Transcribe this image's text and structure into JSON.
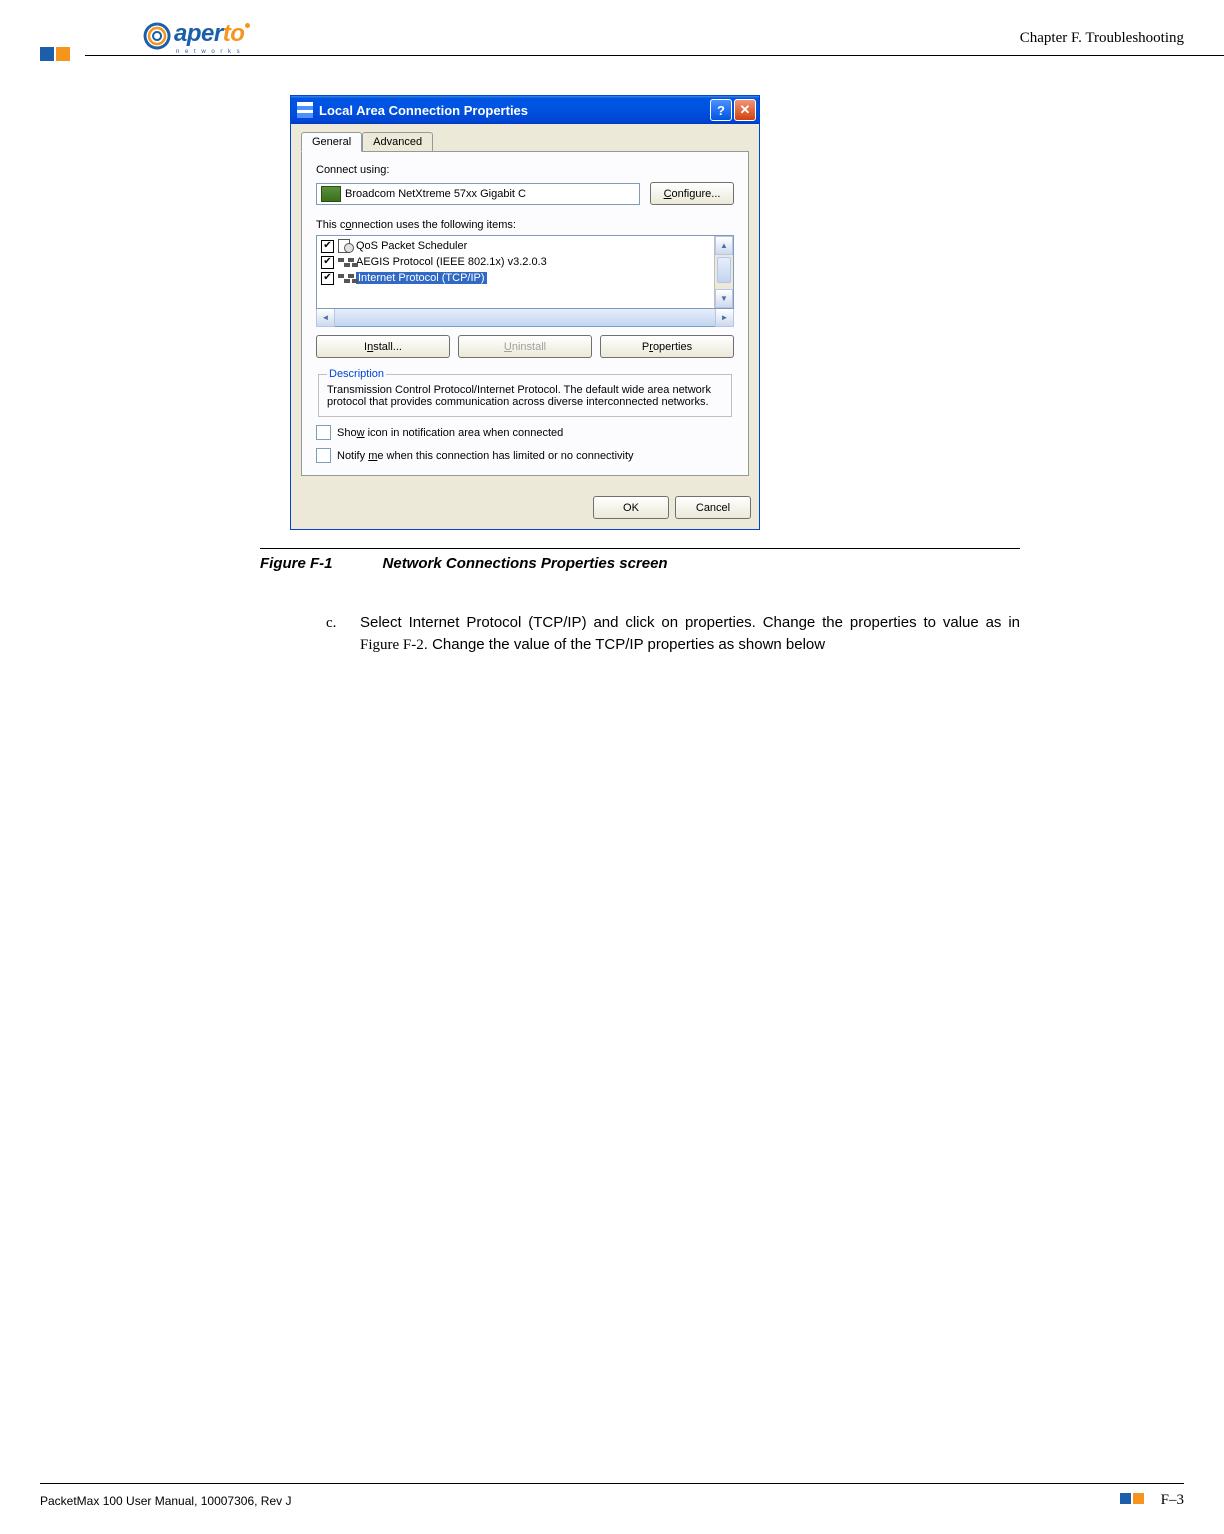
{
  "header": {
    "chapter": "Chapter F.  Troubleshooting",
    "logo_text1": "aper",
    "logo_text2": "to",
    "logo_sub": "n e t w o r k s"
  },
  "dialog": {
    "title": "Local Area Connection Properties",
    "tabs": {
      "general": "General",
      "advanced": "Advanced"
    },
    "connect_using_label": "Connect using:",
    "adapter_name": "Broadcom NetXtreme 57xx Gigabit C",
    "configure_btn": "Configure...",
    "items_label": "This connection uses the following items:",
    "items": [
      {
        "label": "QoS Packet Scheduler",
        "checked": true,
        "selected": false,
        "icon": "sched"
      },
      {
        "label": "AEGIS Protocol (IEEE 802.1x) v3.2.0.3",
        "checked": true,
        "selected": false,
        "icon": "net"
      },
      {
        "label": "Internet Protocol (TCP/IP)",
        "checked": true,
        "selected": true,
        "icon": "net"
      }
    ],
    "install_btn": "Install...",
    "uninstall_btn": "Uninstall",
    "properties_btn": "Properties",
    "desc_legend": "Description",
    "desc_text": "Transmission Control Protocol/Internet Protocol. The default wide area network protocol that provides communication across diverse interconnected networks.",
    "chk_show_icon": "Show icon in notification area when connected",
    "chk_notify": "Notify me when this connection has limited or no connectivity",
    "ok_btn": "OK",
    "cancel_btn": "Cancel"
  },
  "figure": {
    "number": "Figure F-1",
    "caption": "Network Connections Properties screen"
  },
  "step": {
    "marker": "c.",
    "text_pre": "Select Internet Protocol (TCP/IP) and click on properties. Change the properties to value as in ",
    "figref": "Figure F-2",
    "text_post": ". Change the value of the TCP/IP properties as shown below"
  },
  "footer": {
    "manual": "PacketMax 100 User Manual, 10007306, Rev J",
    "page": "F–3"
  }
}
